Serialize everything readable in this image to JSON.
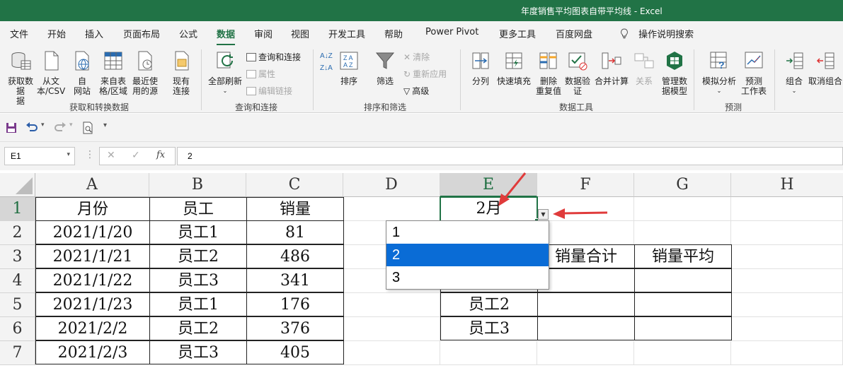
{
  "window": {
    "title": "年度销售平均图表自带平均线  -  Excel"
  },
  "menu": {
    "items": [
      "文件",
      "开始",
      "插入",
      "页面布局",
      "公式",
      "数据",
      "审阅",
      "视图",
      "开发工具",
      "帮助",
      "Power Pivot",
      "更多工具",
      "百度网盘",
      "操作说明搜索"
    ],
    "active": "数据"
  },
  "ribbon": {
    "get_data": {
      "get": "获取数据",
      "get2": "据",
      "text_csv": "从文",
      "text_csv2": "本/CSV",
      "web": "自",
      "web2": "网站",
      "table": "来自表",
      "table2": "格/区域",
      "recent": "最近使",
      "recent2": "用的源",
      "existing": "现有",
      "existing2": "连接",
      "group": "获取和转换数据"
    },
    "queries": {
      "refresh": "全部刷新",
      "qc": "查询和连接",
      "props": "属性",
      "edit_links": "编辑链接",
      "group": "查询和连接"
    },
    "sort": {
      "sort": "排序",
      "filter": "筛选",
      "clear": "清除",
      "reapply": "重新应用",
      "advanced": "高级",
      "group": "排序和筛选"
    },
    "tools": {
      "split": "分列",
      "flash": "快速填充",
      "remove_dup": "删除",
      "remove_dup2": "重复值",
      "validate": "数据验",
      "validate2": "证",
      "consolidate": "合并计算",
      "relations": "关系",
      "model": "管理数",
      "model2": "据模型",
      "group": "数据工具"
    },
    "forecast": {
      "whatif": "模拟分析",
      "sheet": "预测",
      "sheet2": "工作表",
      "group": "预测"
    },
    "outline": {
      "group_btn": "组合",
      "ungroup": "取消组合"
    }
  },
  "formula_bar": {
    "name_box": "E1",
    "value": "2"
  },
  "columns": [
    "A",
    "B",
    "C",
    "D",
    "E",
    "F",
    "G",
    "H"
  ],
  "rows": [
    "1",
    "2",
    "3",
    "4",
    "5",
    "6",
    "7"
  ],
  "table": {
    "headers": [
      "月份",
      "员工",
      "销量"
    ],
    "rows": [
      [
        "2021/1/20",
        "员工1",
        "81"
      ],
      [
        "2021/1/21",
        "员工2",
        "486"
      ],
      [
        "2021/1/22",
        "员工3",
        "341"
      ],
      [
        "2021/1/23",
        "员工1",
        "176"
      ],
      [
        "2021/2/2",
        "员工2",
        "376"
      ],
      [
        "2021/2/3",
        "员工3",
        "405"
      ]
    ]
  },
  "summary": {
    "e1": "2月",
    "f3": "销量合计",
    "g3": "销量平均",
    "e5": "员工2",
    "e6": "员工3"
  },
  "dropdown": {
    "options": [
      "1",
      "2",
      "3"
    ],
    "selected_index": 1
  },
  "colors": {
    "excel_green": "#217346",
    "selection_blue": "#0a6cd6",
    "annotation_red": "#e03b3b"
  }
}
